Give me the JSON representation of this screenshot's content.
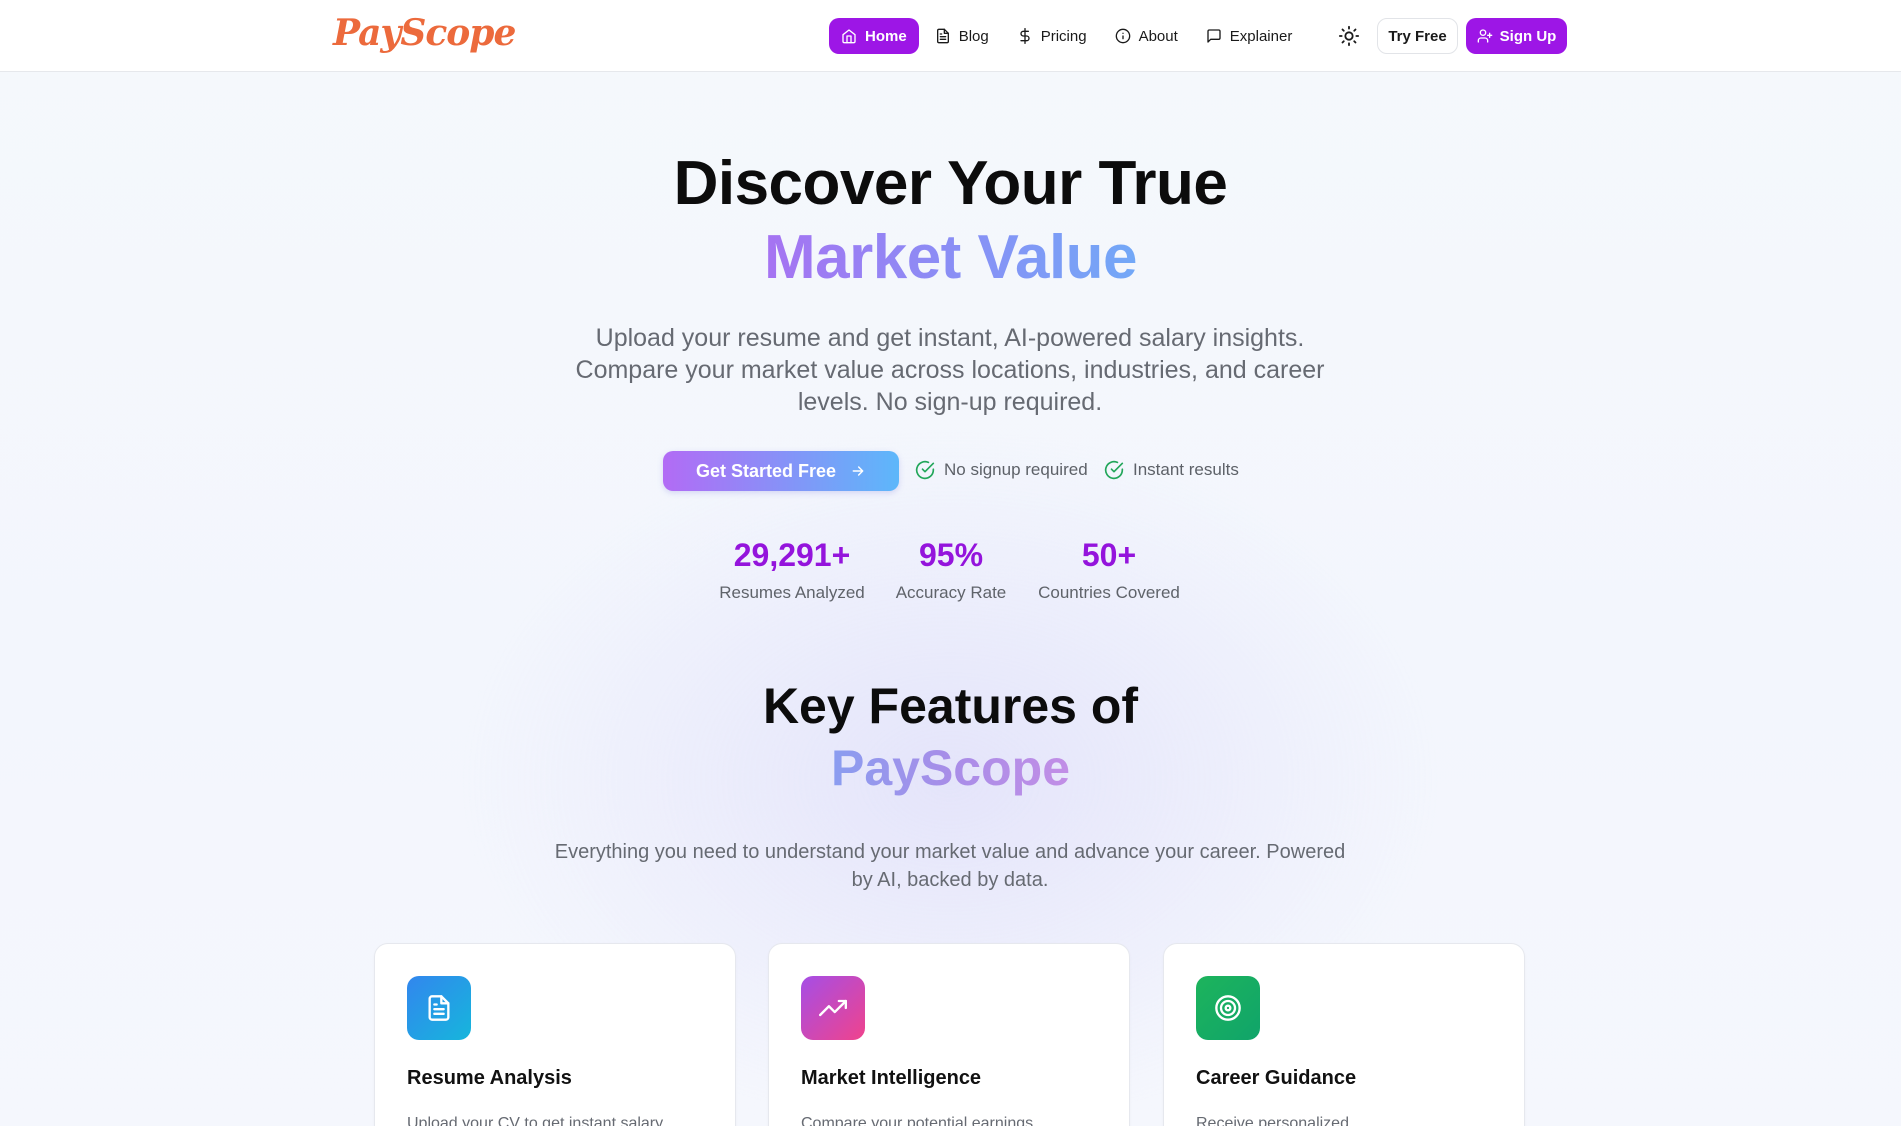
{
  "brand": {
    "logo": "PayScope",
    "color": "#ec6a3c"
  },
  "nav": {
    "items": [
      {
        "label": "Home",
        "icon": "home-icon",
        "active": true
      },
      {
        "label": "Blog",
        "icon": "document-icon",
        "active": false
      },
      {
        "label": "Pricing",
        "icon": "dollar-icon",
        "active": false
      },
      {
        "label": "About",
        "icon": "info-icon",
        "active": false
      },
      {
        "label": "Explainer",
        "icon": "chat-bubble-icon",
        "active": false
      }
    ],
    "theme_icon": "sun-icon",
    "try_free": "Try Free",
    "sign_up": "Sign Up",
    "accent": "#9d16e6"
  },
  "hero": {
    "title_line1": "Discover Your True",
    "title_line2": "Market Value",
    "subtitle": "Upload your resume and get instant, AI-powered salary insights. Compare your market value across locations, industries, and career levels. No sign-up required.",
    "cta": "Get Started Free",
    "checks": [
      "No signup required",
      "Instant results"
    ]
  },
  "stats": [
    {
      "value": "29,291+",
      "label": "Resumes Analyzed"
    },
    {
      "value": "95%",
      "label": "Accuracy Rate"
    },
    {
      "value": "50+",
      "label": "Countries Covered"
    }
  ],
  "features": {
    "title_line1": "Key Features of",
    "title_line2": "PayScope",
    "subtitle": "Everything you need to understand your market value and advance your career. Powered by AI, backed by data.",
    "cards": [
      {
        "title": "Resume Analysis",
        "desc": "Upload your CV to get instant salary",
        "icon": "file-text-icon"
      },
      {
        "title": "Market Intelligence",
        "desc": "Compare your potential earnings",
        "icon": "trending-up-icon"
      },
      {
        "title": "Career Guidance",
        "desc": "Receive personalized",
        "icon": "target-icon"
      }
    ]
  }
}
